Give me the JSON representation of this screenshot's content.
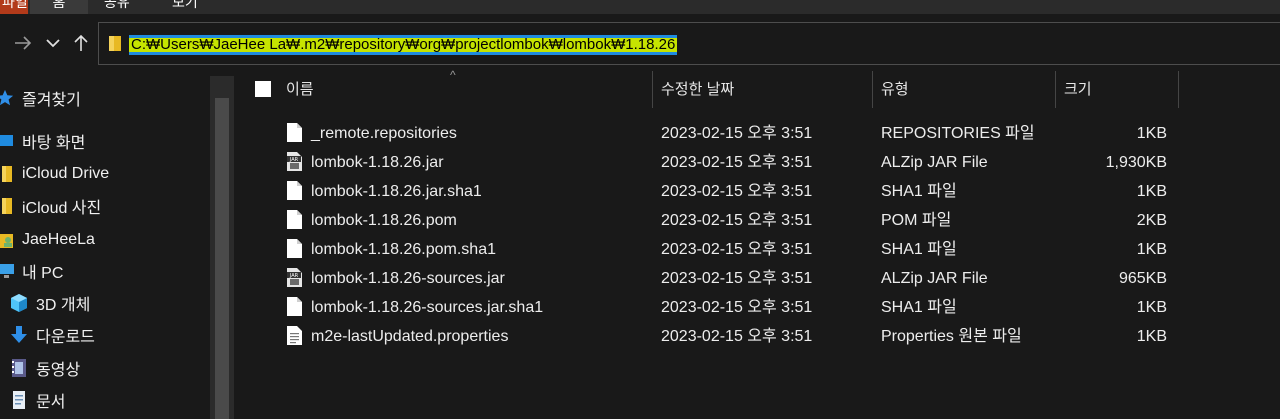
{
  "ribbon": {
    "tabs": [
      "파일",
      "홈",
      "공유",
      "보기"
    ]
  },
  "address": {
    "path": "C:₩Users₩JaeHee La₩.m2₩repository₩org₩projectlombok₩lombok₩1.18.26"
  },
  "sidebar": {
    "items": [
      {
        "label": "즐겨찾기",
        "icon": "star-icon"
      },
      {
        "label": "바탕 화면",
        "icon": "desktop-icon"
      },
      {
        "label": "iCloud Drive",
        "icon": "folder-icon"
      },
      {
        "label": "iCloud 사진",
        "icon": "folder-icon"
      },
      {
        "label": "JaeHeeLa",
        "icon": "user-folder-icon"
      },
      {
        "label": "내 PC",
        "icon": "computer-icon"
      },
      {
        "label": "3D 개체",
        "icon": "cube-icon"
      },
      {
        "label": "다운로드",
        "icon": "download-icon"
      },
      {
        "label": "동영상",
        "icon": "video-icon"
      },
      {
        "label": "문서",
        "icon": "document-icon"
      }
    ]
  },
  "columns": {
    "name": "이름",
    "date": "수정한 날짜",
    "type": "유형",
    "size": "크기"
  },
  "files": [
    {
      "name": "_remote.repositories",
      "date": "2023-02-15 오후 3:51",
      "type": "REPOSITORIES 파일",
      "size": "1KB",
      "icon": "blank-file-icon"
    },
    {
      "name": "lombok-1.18.26.jar",
      "date": "2023-02-15 오후 3:51",
      "type": "ALZip JAR File",
      "size": "1,930KB",
      "icon": "jar-file-icon"
    },
    {
      "name": "lombok-1.18.26.jar.sha1",
      "date": "2023-02-15 오후 3:51",
      "type": "SHA1 파일",
      "size": "1KB",
      "icon": "blank-file-icon"
    },
    {
      "name": "lombok-1.18.26.pom",
      "date": "2023-02-15 오후 3:51",
      "type": "POM 파일",
      "size": "2KB",
      "icon": "blank-file-icon"
    },
    {
      "name": "lombok-1.18.26.pom.sha1",
      "date": "2023-02-15 오후 3:51",
      "type": "SHA1 파일",
      "size": "1KB",
      "icon": "blank-file-icon"
    },
    {
      "name": "lombok-1.18.26-sources.jar",
      "date": "2023-02-15 오후 3:51",
      "type": "ALZip JAR File",
      "size": "965KB",
      "icon": "jar-file-icon"
    },
    {
      "name": "lombok-1.18.26-sources.jar.sha1",
      "date": "2023-02-15 오후 3:51",
      "type": "SHA1 파일",
      "size": "1KB",
      "icon": "blank-file-icon"
    },
    {
      "name": "m2e-lastUpdated.properties",
      "date": "2023-02-15 오후 3:51",
      "type": "Properties 원본 파일",
      "size": "1KB",
      "icon": "text-file-icon"
    }
  ],
  "colors": {
    "background": "#191919",
    "text": "#ededed",
    "address_highlight": "#c6e400",
    "selection_blue": "#1f8be0"
  }
}
